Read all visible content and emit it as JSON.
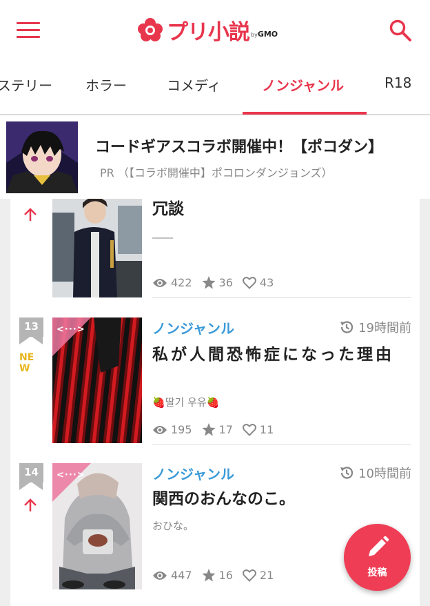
{
  "header": {
    "logo_text": "プリ小説",
    "logo_by": "by",
    "logo_gmo": "GMO"
  },
  "tabs": [
    {
      "label": "ステリー",
      "active": false
    },
    {
      "label": "ホラー",
      "active": false
    },
    {
      "label": "コメディ",
      "active": false
    },
    {
      "label": "ノンジャンル",
      "active": true
    },
    {
      "label": "R18",
      "active": false
    }
  ],
  "ad": {
    "title": "コードギアスコラボ開催中！【ポコダン】",
    "sub": "PR （【コラボ開催中】ポコロンダンジョンズ）"
  },
  "items": [
    {
      "title": "冗談",
      "author": "____",
      "views": "422",
      "stars": "36",
      "likes": "43"
    },
    {
      "rank": "13",
      "badge": "NEW",
      "genre": "ノンジャンル",
      "time": "19時間前",
      "title": "私が人間恐怖症になった理由",
      "author": "🍓딸기 우유🍓",
      "views": "195",
      "stars": "17",
      "likes": "11"
    },
    {
      "rank": "14",
      "genre": "ノンジャンル",
      "time": "10時間前",
      "title": "関西のおんなのこ。",
      "author": "おひな。",
      "views": "447",
      "stars": "16",
      "likes": "21"
    }
  ],
  "fab": {
    "label": "投稿"
  },
  "colors": {
    "accent": "#e8364d",
    "genre": "#3a9ad8",
    "new_badge": "#e8b51c"
  }
}
